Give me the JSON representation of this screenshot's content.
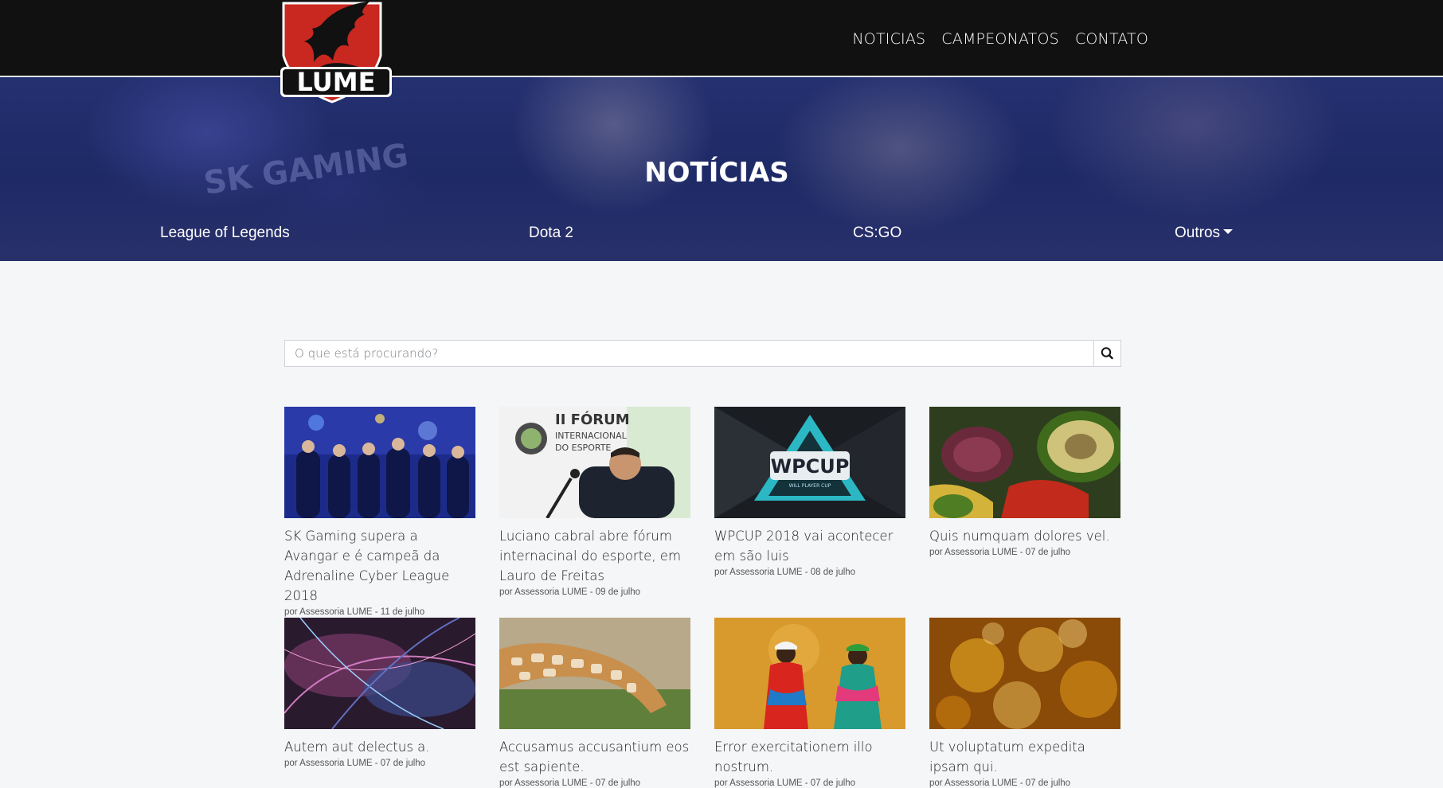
{
  "brand": {
    "logo_text": "LUME"
  },
  "nav": {
    "items": [
      "NOTICIAS",
      "CAMPEONATOS",
      "CONTATO"
    ]
  },
  "hero": {
    "title": "NOTÍCIAS",
    "watermark": "SK GAMING",
    "categories": [
      "League of Legends",
      "Dota 2",
      "CS:GO",
      "Outros"
    ]
  },
  "search": {
    "placeholder": "O que está procurando?",
    "icon": "search-icon"
  },
  "byline_prefix": "por",
  "articles": [
    {
      "title": "SK Gaming supera a Avangar e é campeã da Adrenaline Cyber League 2018",
      "author": "Assessoria LUME",
      "date": "11 de julho",
      "meta": "por Assessoria LUME - 11 de julho"
    },
    {
      "title": "Luciano cabral abre fórum internacinal do esporte, em Lauro de Freitas",
      "author": "Assessoria LUME",
      "date": "09 de julho",
      "meta": "por Assessoria LUME - 09 de julho"
    },
    {
      "title": "WPCUP 2018 vai acontecer em são luis",
      "author": "Assessoria LUME",
      "date": "08 de julho",
      "meta": "por Assessoria LUME - 08 de julho"
    },
    {
      "title": "Quis numquam dolores vel.",
      "author": "Assessoria LUME",
      "date": "07 de julho",
      "meta": "por Assessoria LUME - 07 de julho"
    },
    {
      "title": "Autem aut delectus a.",
      "author": "Assessoria LUME",
      "date": "07 de julho",
      "meta": "por Assessoria LUME - 07 de julho"
    },
    {
      "title": "Accusamus accusantium eos est sapiente.",
      "author": "Assessoria LUME",
      "date": "07 de julho",
      "meta": "por Assessoria LUME - 07 de julho"
    },
    {
      "title": "Error exercitationem illo nostrum.",
      "author": "Assessoria LUME",
      "date": "07 de julho",
      "meta": "por Assessoria LUME - 07 de julho"
    },
    {
      "title": "Ut voluptatum expedita ipsam qui.",
      "author": "Assessoria LUME",
      "date": "07 de julho",
      "meta": "por Assessoria LUME - 07 de julho"
    }
  ],
  "thumb_text": {
    "forum_line1": "II FÓRUM",
    "forum_line2": "INTERNACIONAL",
    "forum_line3": "DO ESPORTE",
    "wpcup": "WPCUP",
    "wpcup_sub": "WILL PLAYER CUP"
  },
  "colors": {
    "topbar": "#111111",
    "hero": "#243070",
    "page_bg": "#f4f6f8",
    "logo_red": "#c8281f"
  }
}
